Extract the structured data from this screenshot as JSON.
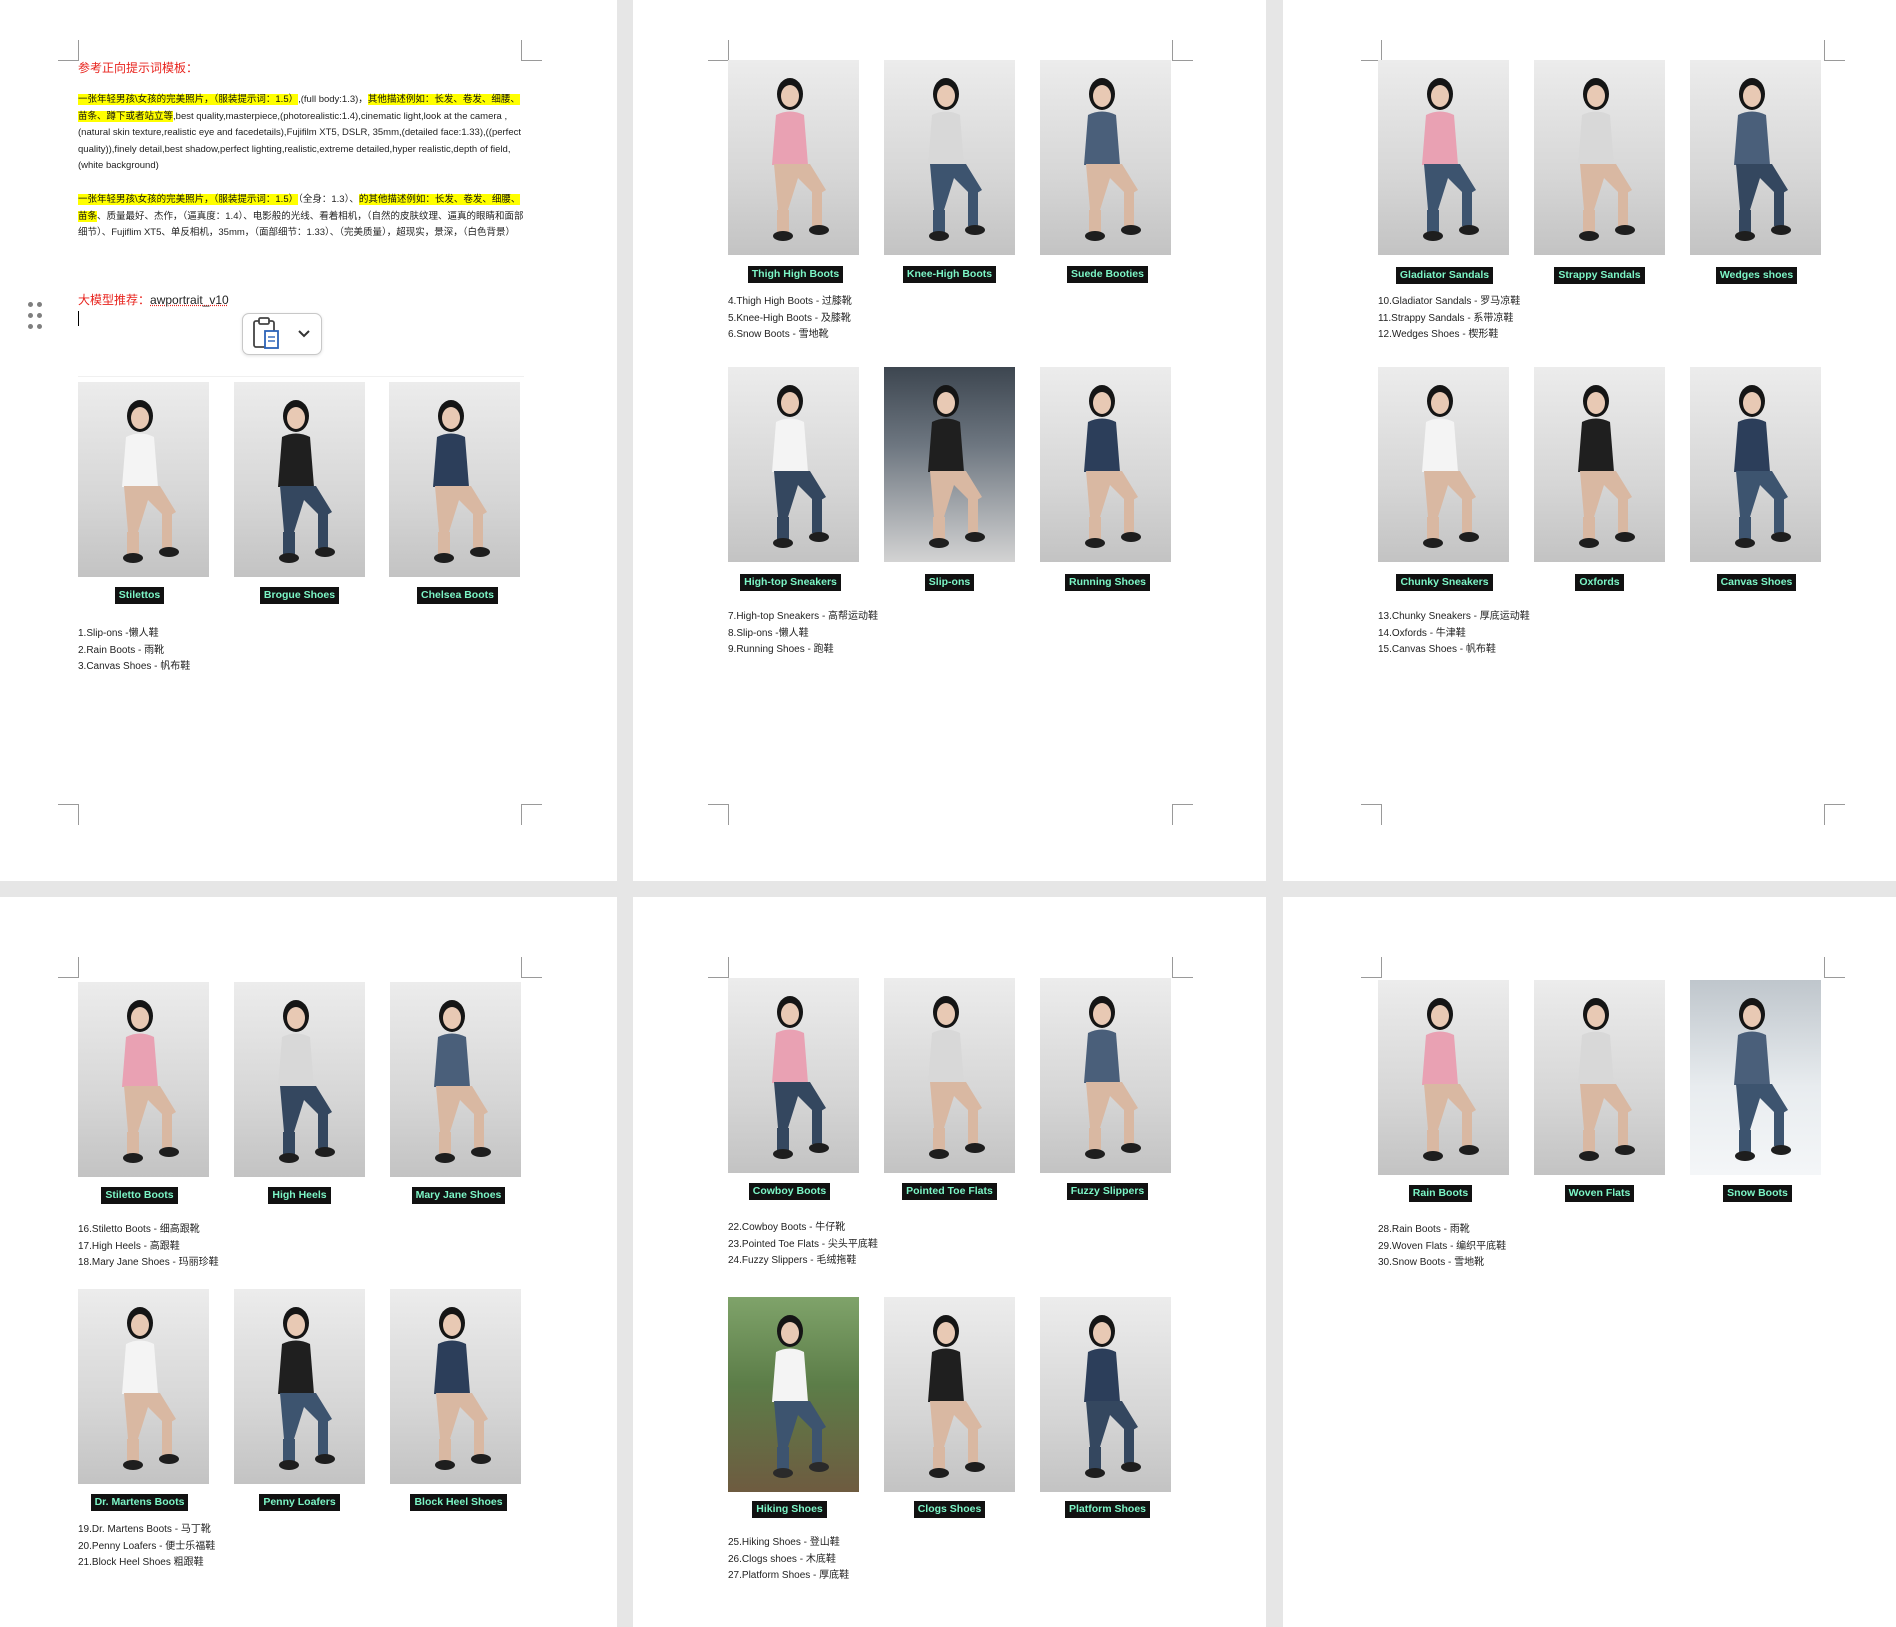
{
  "page1": {
    "title": "参考正向提示词模板：",
    "para1_highlight_a": "一张年轻男孩\\女孩的完美照片，（服装提示词：1.5）",
    "para1_text_a": ",(full body:1.3)，",
    "para1_highlight_b": "其他描述例如：长发、卷发、细腰、苗条、蹲下或者站立等",
    "para1_text_b": ",best quality,masterpiece,(photorealistic:1.4),cinematic light,look at the camera ,(natural skin texture,realistic eye and facedetails),Fujifilm XT5, DSLR, 35mm,(detailed face:1.33),((perfect quality)),finely detail,best shadow,perfect lighting,realistic,extreme detailed,hyper realistic,depth of field,(white background)",
    "para2_highlight_a": "一张年轻男孩\\女孩的完美照片，（服装提示词：1.5）",
    "para2_text_a": "（全身：1.3）、",
    "para2_highlight_b": "的其他描述例如：长发、卷发、细腰、苗条",
    "para2_text_b": "、质量最好、杰作，（逼真度：1.4）、电影般的光线、看着相机，（自然的皮肤纹理、逼真的眼睛和面部细节）、Fujiflim XT5、单反相机，35mm，（面部细节：1.33）、（完美质量），超现实，景深，（白色背景）",
    "model_label": "大模型推荐：",
    "model_value": "awportrait_v10",
    "captions": [
      "Stilettos",
      "Brogue Shoes",
      "Chelsea Boots"
    ],
    "list": [
      "1.Slip-ons -懒人鞋",
      "2.Rain Boots - 雨靴",
      "3.Canvas Shoes - 帆布鞋"
    ],
    "icons": {
      "drag": "drag-handle-icon",
      "paste": "clipboard-paste-icon",
      "chevron": "chevron-down-icon"
    }
  },
  "page2": {
    "captions_a": [
      "Thigh High Boots",
      "Knee-High Boots",
      "Suede Booties"
    ],
    "list_a": [
      "4.Thigh High Boots - 过膝靴",
      "5.Knee-High Boots - 及膝靴",
      "6.Snow Boots - 雪地靴"
    ],
    "captions_b": [
      "High-top Sneakers",
      "Slip-ons",
      "Running Shoes"
    ],
    "list_b": [
      "7.High-top Sneakers - 高帮运动鞋",
      "8.Slip-ons -懒人鞋",
      "9.Running Shoes - 跑鞋"
    ]
  },
  "page3": {
    "captions_a": [
      "Gladiator Sandals",
      "Strappy Sandals",
      "Wedges shoes"
    ],
    "list_a": [
      "10.Gladiator Sandals - 罗马凉鞋",
      "11.Strappy Sandals - 系带凉鞋",
      "12.Wedges Shoes - 楔形鞋"
    ],
    "captions_b": [
      "Chunky Sneakers",
      "Oxfords",
      "Canvas Shoes"
    ],
    "list_b": [
      "13.Chunky Sneakers - 厚底运动鞋",
      "14.Oxfords - 牛津鞋",
      "15.Canvas Shoes - 帆布鞋"
    ]
  },
  "page4": {
    "captions_a": [
      "Stiletto Boots",
      "High Heels",
      "Mary Jane Shoes"
    ],
    "list_a": [
      "16.Stiletto Boots - 细高跟靴",
      "17.High Heels - 高跟鞋",
      "18.Mary Jane Shoes - 玛丽珍鞋"
    ],
    "captions_b": [
      "Dr. Martens Boots",
      "Penny Loafers",
      "Block Heel Shoes"
    ],
    "list_b": [
      "19.Dr. Martens Boots - 马丁靴",
      "20.Penny Loafers - 便士乐福鞋",
      "21.Block Heel Shoes 粗跟鞋"
    ]
  },
  "page5": {
    "captions_a": [
      "Cowboy Boots",
      "Pointed Toe Flats",
      "Fuzzy Slippers"
    ],
    "list_a": [
      "22.Cowboy Boots - 牛仔靴",
      "23.Pointed Toe Flats - 尖头平底鞋",
      "24.Fuzzy Slippers - 毛绒拖鞋"
    ],
    "captions_b": [
      "Hiking Shoes",
      "Clogs Shoes",
      "Platform Shoes"
    ],
    "list_b": [
      "25.Hiking Shoes - 登山鞋",
      "26.Clogs shoes - 木底鞋",
      "27.Platform Shoes - 厚底鞋"
    ]
  },
  "page6": {
    "captions_a": [
      "Rain Boots",
      "Woven Flats",
      "Snow Boots"
    ],
    "list_a": [
      "28.Rain Boots - 雨靴",
      "29.Woven Flats - 编织平底鞋",
      "30.Snow Boots - 雪地靴"
    ]
  },
  "colors": {
    "page_bg": "#ffffff",
    "canvas_bg": "#e6e6e6",
    "caption_bg": "#111111",
    "caption_text": "#7cf5c6",
    "highlight": "#ffff00",
    "title_red": "#e8231d"
  }
}
